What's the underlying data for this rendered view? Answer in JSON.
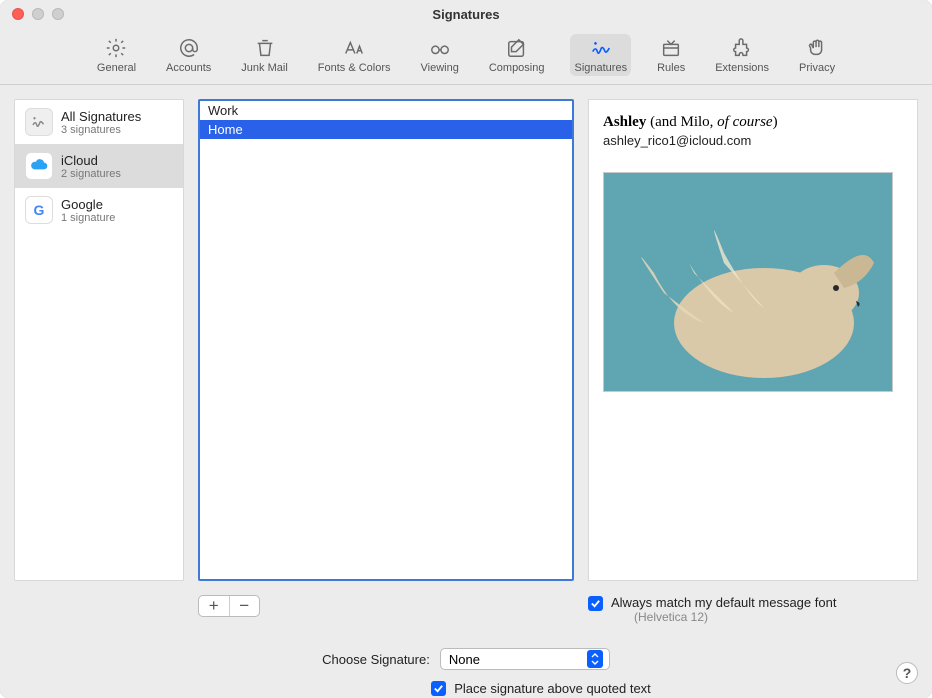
{
  "window": {
    "title": "Signatures"
  },
  "toolbar": {
    "items": [
      {
        "label": "General"
      },
      {
        "label": "Accounts"
      },
      {
        "label": "Junk Mail"
      },
      {
        "label": "Fonts & Colors"
      },
      {
        "label": "Viewing"
      },
      {
        "label": "Composing"
      },
      {
        "label": "Signatures"
      },
      {
        "label": "Rules"
      },
      {
        "label": "Extensions"
      },
      {
        "label": "Privacy"
      }
    ]
  },
  "accounts": [
    {
      "title": "All Signatures",
      "sub": "3 signatures"
    },
    {
      "title": "iCloud",
      "sub": "2 signatures"
    },
    {
      "title": "Google",
      "sub": "1 signature"
    }
  ],
  "signatures": [
    {
      "name": "Work"
    },
    {
      "name": "Home"
    }
  ],
  "preview": {
    "name_bold": "Ashley",
    "name_paren_prefix": " (and Milo, ",
    "name_italic": "of course",
    "name_paren_suffix": ")",
    "email": "ashley_rico1@icloud.com"
  },
  "controls": {
    "match_font_label": "Always match my default message font",
    "match_font_sub": "(Helvetica 12)",
    "choose_label": "Choose Signature:",
    "choose_value": "None",
    "place_label": "Place signature above quoted text"
  }
}
